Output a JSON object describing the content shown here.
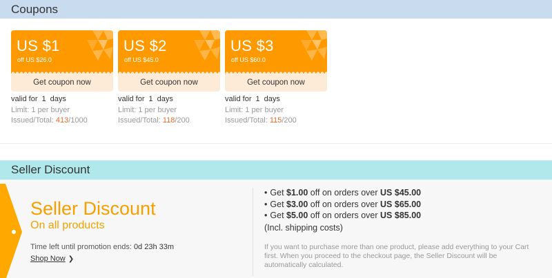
{
  "coupons_section": {
    "title": "Coupons",
    "coupons": [
      {
        "amount": "US $1",
        "min_order": "off US $26.0",
        "button": "Get coupon now",
        "valid_prefix": "valid for",
        "valid_days": "1",
        "valid_suffix": "days",
        "limit": "Limit: 1 per buyer",
        "issued_label": "Issued/Total:",
        "issued": "413",
        "total": "/1000"
      },
      {
        "amount": "US $2",
        "min_order": "off US $45.0",
        "button": "Get coupon now",
        "valid_prefix": "valid for",
        "valid_days": "1",
        "valid_suffix": "days",
        "limit": "Limit: 1 per buyer",
        "issued_label": "Issued/Total:",
        "issued": "118",
        "total": "/200"
      },
      {
        "amount": "US $3",
        "min_order": "off US $60.0",
        "button": "Get coupon now",
        "valid_prefix": "valid for",
        "valid_days": "1",
        "valid_suffix": "days",
        "limit": "Limit: 1 per buyer",
        "issued_label": "Issued/Total:",
        "issued": "115",
        "total": "/200"
      }
    ]
  },
  "seller_discount": {
    "header": "Seller Discount",
    "title": "Seller Discount",
    "subtitle": "On all products",
    "time_left_label": "Time left until promotion ends:",
    "time_left_value": "0d 23h 33m",
    "shop_now": "Shop Now",
    "offers": [
      {
        "pre": "Get",
        "discount": "$1.00",
        "mid": "off on orders over",
        "threshold": "US $45.00"
      },
      {
        "pre": "Get",
        "discount": "$3.00",
        "mid": "off on orders over",
        "threshold": "US $65.00"
      },
      {
        "pre": "Get",
        "discount": "$5.00",
        "mid": "off on orders over",
        "threshold": "US $85.00"
      }
    ],
    "shipping_note": "(Incl. shipping costs)",
    "cart_note": "If you want to purchase more than one product, please add everything to your Cart first. When you proceed to the checkout page, the Seller Discount will be automatically calculated."
  },
  "colors": {
    "coupon_orange": "#ff9900",
    "coupon_button_bg": "#fdebd8",
    "issued_highlight": "#e96a26",
    "coupons_header_bg": "#c9dcef",
    "seller_header_bg": "#b0e8ec",
    "seller_title": "#f5a000"
  }
}
